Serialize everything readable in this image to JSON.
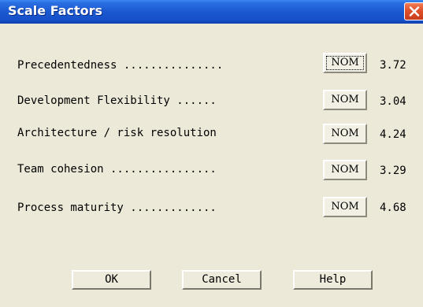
{
  "window": {
    "title": "Scale Factors"
  },
  "factors": [
    {
      "label": "Precedentedness ...............",
      "rating": "NOM",
      "value": "3.72"
    },
    {
      "label": "Development Flexibility ......",
      "rating": "NOM",
      "value": "3.04"
    },
    {
      "label": "Architecture / risk resolution",
      "rating": "NOM",
      "value": "4.24"
    },
    {
      "label": "Team cohesion ................",
      "rating": "NOM",
      "value": "3.29"
    },
    {
      "label": "Process maturity .............",
      "rating": "NOM",
      "value": "4.68"
    }
  ],
  "buttons": {
    "ok": "OK",
    "cancel": "Cancel",
    "help": "Help"
  },
  "icons": {
    "close": "close-icon"
  },
  "colors": {
    "titlebar": "#1a58d0",
    "dialog_background": "#ece9d8",
    "close_button": "#e0502a"
  }
}
